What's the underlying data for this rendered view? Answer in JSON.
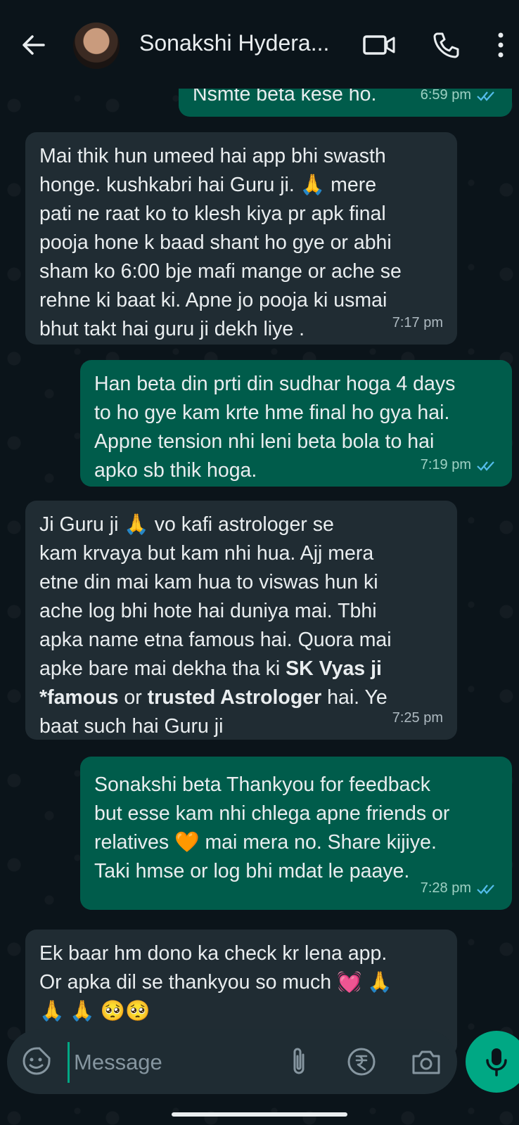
{
  "header": {
    "contact_name": "Sonakshi Hydera...",
    "icons": [
      "back-arrow-icon",
      "avatar",
      "video-call-icon",
      "voice-call-icon",
      "more-vert-icon"
    ]
  },
  "messages": [
    {
      "direction": "out",
      "text": "Nsmte beta kese ho.",
      "time": "6:59 pm",
      "status": "read"
    },
    {
      "direction": "in",
      "lines": [
        "Mai thik hun umeed hai app bhi swasth",
        "honge. kushkabri hai Guru ji. 🙏  mere",
        "pati ne  raat ko to klesh kiya pr apk final",
        "pooja hone k baad shant ho gye or abhi",
        "sham ko 6:00 bje mafi mange or ache se",
        "rehne ki baat ki. Apne jo pooja ki usmai",
        "bhut takt hai guru ji dekh liye ."
      ],
      "time": "7:17 pm"
    },
    {
      "direction": "out",
      "lines": [
        "Han beta din prti din sudhar hoga 4 days",
        "to ho gye kam krte hme final ho gya hai.",
        "Appne tension  nhi leni beta bola to hai",
        "apko sb thik hoga."
      ],
      "time": "7:19 pm",
      "status": "read"
    },
    {
      "direction": "in",
      "lines": [
        "Ji Guru ji 🙏  vo kafi astrologer  se",
        "kam krvaya but kam nhi hua. Ajj mera",
        "etne din mai kam hua to viswas hun ki",
        "ache log bhi hote hai duniya mai. Tbhi",
        "apka name etna famous hai. Quora mai"
      ],
      "line6_pre": "apke bare mai dekha tha ki ",
      "line6_bold": "SK Vyas ji",
      "line7_bold1": "*famous",
      "line7_mid": " or ",
      "line7_bold2": "trusted Astrologer",
      "line7_post": "  hai. Ye",
      "line8": "baat such hai Guru ji",
      "time": "7:25 pm"
    },
    {
      "direction": "out",
      "lines": [
        "Sonakshi beta Thankyou for feedback",
        "but esse kam nhi chlega apne friends or",
        "relatives 🧡  mai mera no. Share kijiye.",
        "Taki hmse or log bhi mdat le paaye."
      ],
      "time": "7:28 pm",
      "status": "read"
    },
    {
      "direction": "in",
      "lines": [
        "Ek baar hm dono ka check kr lena app.",
        "Or apka dil se thankyou so much 💓  🙏",
        "🙏 🙏 🥺🥺"
      ]
    }
  ],
  "composer": {
    "placeholder": "Message",
    "icons": [
      "emoji-sticker-icon",
      "attach-clip-icon",
      "rupee-payment-icon",
      "camera-icon",
      "mic-icon"
    ]
  },
  "colors": {
    "background": "#0b141a",
    "incoming_bubble": "#202c33",
    "outgoing_bubble": "#005c4b",
    "accent": "#00a884",
    "read_ticks": "#53bdeb"
  }
}
